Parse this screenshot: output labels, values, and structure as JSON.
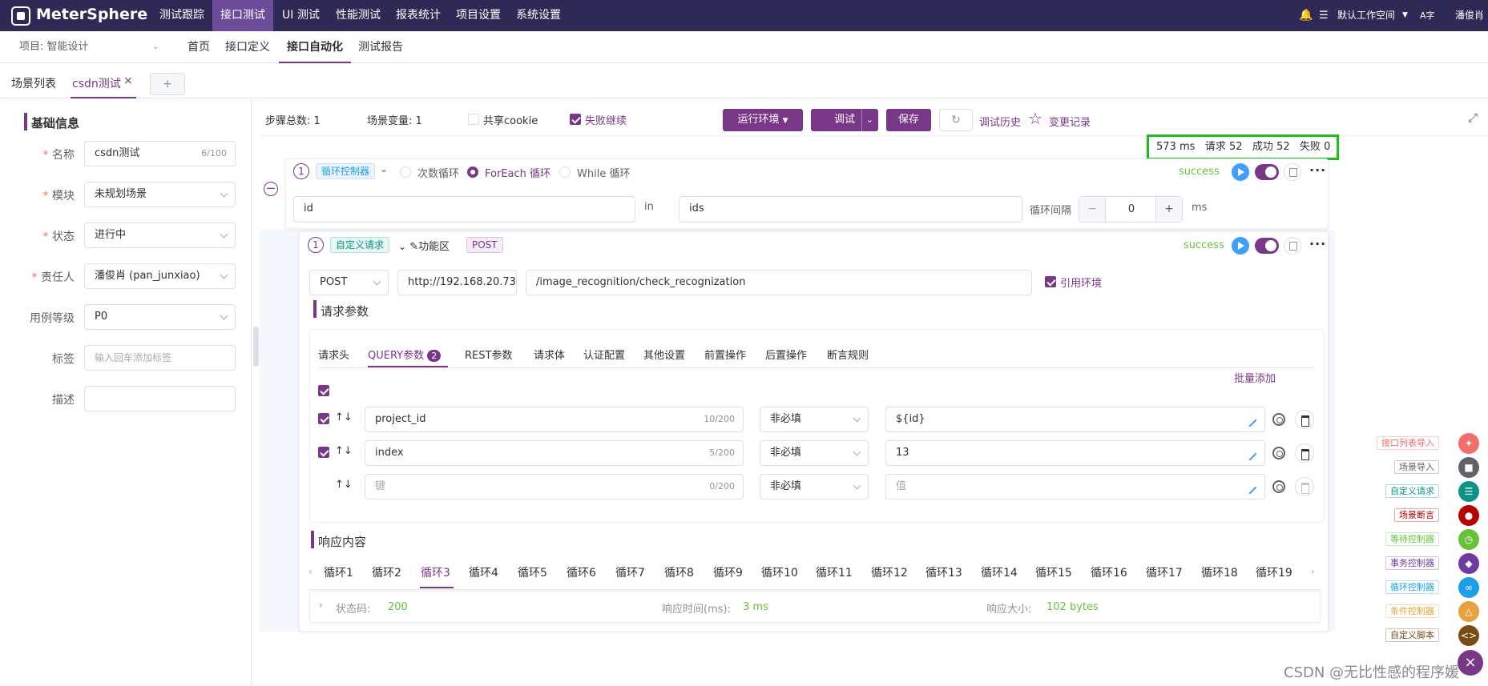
{
  "app": {
    "name": "MeterSphere"
  },
  "topnav": {
    "items": [
      "测试跟踪",
      "接口测试",
      "UI 测试",
      "性能测试",
      "报表统计",
      "项目设置",
      "系统设置"
    ],
    "active": 1
  },
  "topright": {
    "workspace": "默认工作空间",
    "lang": "A字",
    "user": "潘俊肖"
  },
  "subnav": {
    "project": "项目: 智能设计",
    "items": [
      "首页",
      "接口定义",
      "接口自动化",
      "测试报告"
    ],
    "active": 2
  },
  "tabs": {
    "list_label": "场景列表",
    "active_tab": "csdn测试",
    "add": "+"
  },
  "left": {
    "title": "基础信息",
    "fields": [
      {
        "label": "名称",
        "required": true,
        "value": "csdn测试",
        "counter": "6/100"
      },
      {
        "label": "模块",
        "required": true,
        "value": "未规划场景"
      },
      {
        "label": "状态",
        "required": true,
        "value": "进行中"
      },
      {
        "label": "责任人",
        "required": true,
        "value": "潘俊肖 (pan_junxiao)"
      },
      {
        "label": "用例等级",
        "required": false,
        "value": "P0"
      },
      {
        "label": "标签",
        "required": false,
        "placeholder": "输入回车添加标签"
      },
      {
        "label": "描述",
        "required": false,
        "value": ""
      }
    ]
  },
  "toolbar": {
    "steps_label": "步骤总数:",
    "steps": "1",
    "vars_label": "场景变量:",
    "vars": "1",
    "cookie": "共享cookie",
    "fail": "失败继续",
    "env": "运行环境",
    "debug": "调试",
    "save": "保存",
    "history": "调试历史",
    "changes": "变更记录"
  },
  "stats": {
    "time": "573 ms",
    "req_label": "请求",
    "req": "52",
    "ok_label": "成功",
    "ok": "52",
    "fail_label": "失败",
    "fail": "0"
  },
  "loop": {
    "index": "1",
    "tag": "循环控制器",
    "types": [
      "次数循环",
      "ForEach 循环",
      "While 循环"
    ],
    "selected": 1,
    "status": "success",
    "var": "id",
    "in": "in",
    "collection": "ids",
    "interval_label": "循环间隔",
    "interval": "0",
    "unit": "ms"
  },
  "request": {
    "index": "1",
    "tag": "自定义请求",
    "func": "功能区",
    "method_tag": "POST",
    "status": "success",
    "method": "POST",
    "host": "http://192.168.20.73",
    "path": "/image_recognition/check_recognization",
    "use_env": "引用环境",
    "params_title": "请求参数",
    "tabs": [
      "请求头",
      "QUERY参数",
      "REST参数",
      "请求体",
      "认证配置",
      "其他设置",
      "前置操作",
      "后置操作",
      "断言规则"
    ],
    "query_count": "2",
    "batch_add": "批量添加",
    "rows": [
      {
        "key": "project_id",
        "counter": "10/200",
        "required": "非必填",
        "value": "${id}"
      },
      {
        "key": "index",
        "counter": "5/200",
        "required": "非必填",
        "value": "13"
      },
      {
        "key_placeholder": "键",
        "counter": "0/200",
        "required": "非必填",
        "value_placeholder": "值"
      }
    ],
    "response_title": "响应内容",
    "cycles": [
      "循环1",
      "循环2",
      "循环3",
      "循环4",
      "循环5",
      "循环6",
      "循环7",
      "循环8",
      "循环9",
      "循环10",
      "循环11",
      "循环12",
      "循环13",
      "循环14",
      "循环15",
      "循环16",
      "循环17",
      "循环18",
      "循环19"
    ],
    "cycle_active": 2,
    "status_code_label": "状态码:",
    "status_code": "200",
    "resp_time_label": "响应时间(ms):",
    "resp_time": "3 ms",
    "resp_size_label": "响应大小:",
    "resp_size": "102 bytes"
  },
  "right_sidebar": [
    {
      "label": "接口列表导入",
      "color": "#f56c6c"
    },
    {
      "label": "场景导入",
      "color": "#606266"
    },
    {
      "label": "自定义请求",
      "color": "#0d9488"
    },
    {
      "label": "场景断言",
      "color": "#b80000"
    },
    {
      "label": "等待控制器",
      "color": "#67c23a"
    },
    {
      "label": "事务控制器",
      "color": "#6d3c9e"
    },
    {
      "label": "循环控制器",
      "color": "#1c9ee8"
    },
    {
      "label": "条件控制器",
      "color": "#e6a23c"
    },
    {
      "label": "自定义脚本",
      "color": "#7b4b16"
    }
  ],
  "watermark": "CSDN @无比性感的程序媛"
}
